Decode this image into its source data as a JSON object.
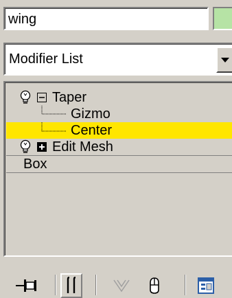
{
  "name_field": {
    "value": "wing"
  },
  "object_color": "#b6e3a5",
  "modifier_list": {
    "selected": "Modifier List"
  },
  "stack": {
    "items": [
      {
        "label": "Taper",
        "type": "modifier",
        "expanded": true,
        "enabled": true
      },
      {
        "label": "Gizmo",
        "type": "sub-object"
      },
      {
        "label": "Center",
        "type": "sub-object",
        "selected": true
      },
      {
        "label": "Edit Mesh",
        "type": "modifier",
        "expanded": false,
        "enabled": true
      },
      {
        "label": "Box",
        "type": "base-object"
      }
    ]
  },
  "toolbar": {
    "buttons": [
      {
        "icon": "pin-stack-icon"
      },
      {
        "icon": "show-end-result-icon",
        "pressed": true
      },
      {
        "icon": "make-unique-icon",
        "disabled": true
      },
      {
        "icon": "remove-modifier-icon"
      },
      {
        "icon": "configure-modifier-sets-icon"
      }
    ]
  },
  "colors": {
    "panel": "#d4d0c8",
    "selection": "#ffe600",
    "field": "#ffffff",
    "icon_blue": "#2c5fa8"
  }
}
